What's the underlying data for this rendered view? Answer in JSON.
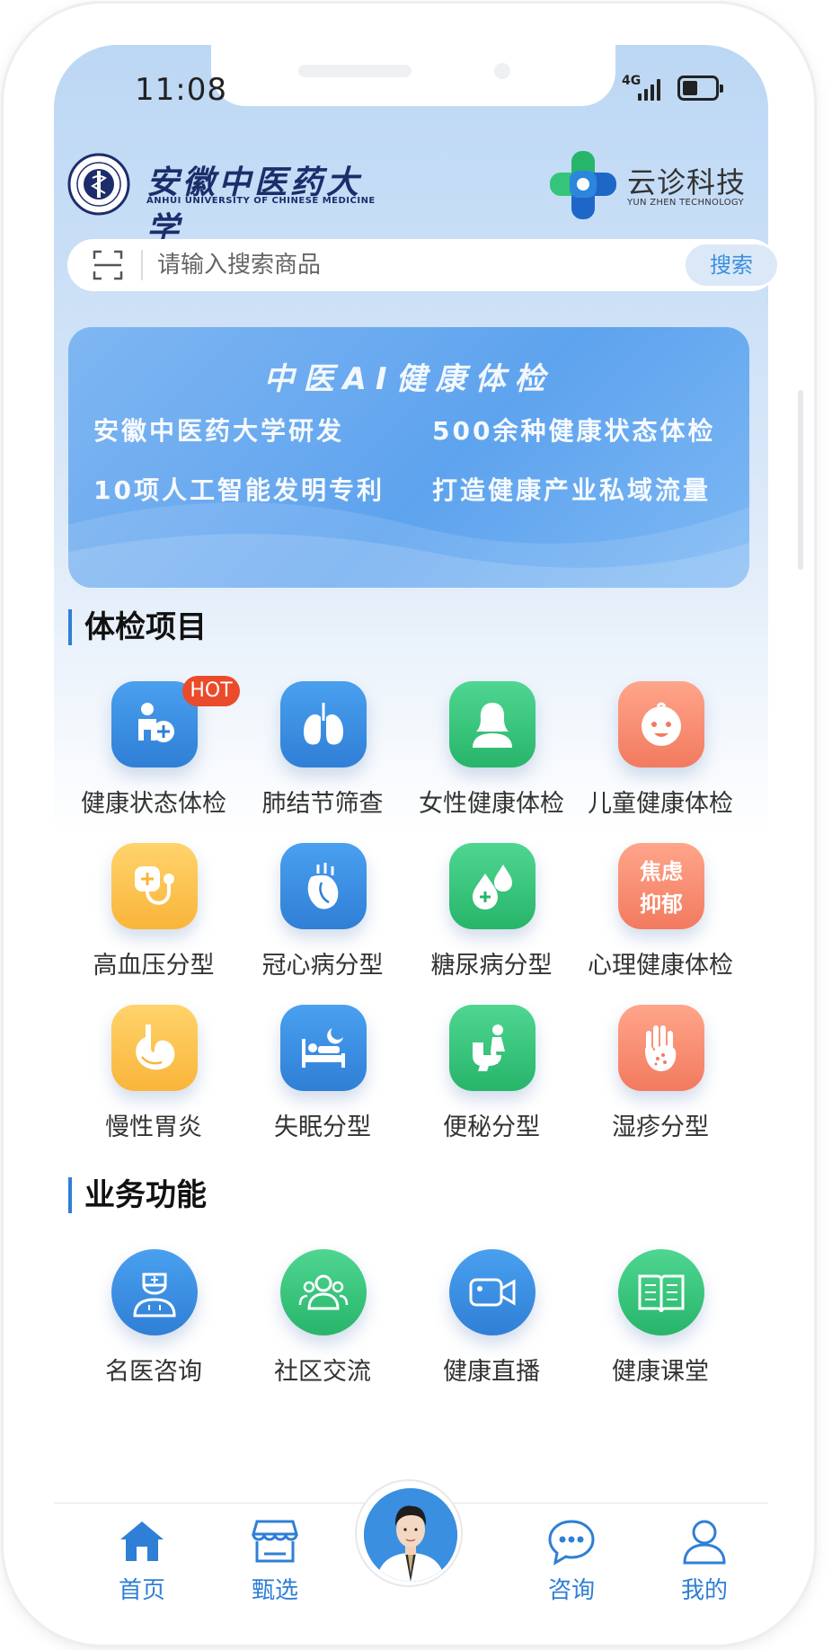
{
  "status_bar": {
    "time": "11:08",
    "network": "4G"
  },
  "header": {
    "university_cn": "安徽中医药大学",
    "university_en": "ANHUI UNIVERSITY OF CHINESE MEDICINE",
    "brand_cn": "云诊科技",
    "brand_en": "YUN ZHEN TECHNOLOGY"
  },
  "search": {
    "placeholder": "请输入搜索商品",
    "button_label": "搜索"
  },
  "banner": {
    "title": "中医AI健康体检",
    "items": [
      "安徽中医药大学研发",
      "500余种健康状态体检",
      "10项人工智能发明专利",
      "打造健康产业私域流量"
    ]
  },
  "exam_section": {
    "title": "体检项目",
    "hot_badge": "HOT",
    "items": [
      {
        "label": "健康状态体检",
        "icon": "person-plus-icon",
        "color": "#2f7fd6"
      },
      {
        "label": "肺结节筛查",
        "icon": "lungs-icon",
        "color": "#2f7fd6"
      },
      {
        "label": "女性健康体检",
        "icon": "woman-icon",
        "color": "#27b56a"
      },
      {
        "label": "儿童健康体检",
        "icon": "baby-face-icon",
        "color": "#f27a5f"
      },
      {
        "label": "高血压分型",
        "icon": "stethoscope-icon",
        "color": "#f9b53a"
      },
      {
        "label": "冠心病分型",
        "icon": "heart-organ-icon",
        "color": "#2f7fd6"
      },
      {
        "label": "糖尿病分型",
        "icon": "drops-icon",
        "color": "#27b56a"
      },
      {
        "label": "心理健康体检",
        "icon": "anxiety-text-icon",
        "color": "#f27a5f",
        "tile_text": [
          "焦虑",
          "抑郁"
        ]
      },
      {
        "label": "慢性胃炎",
        "icon": "stomach-icon",
        "color": "#f9b53a"
      },
      {
        "label": "失眠分型",
        "icon": "bed-moon-icon",
        "color": "#2f7fd6"
      },
      {
        "label": "便秘分型",
        "icon": "toilet-person-icon",
        "color": "#27b56a"
      },
      {
        "label": "湿疹分型",
        "icon": "hand-rash-icon",
        "color": "#f27a5f"
      }
    ]
  },
  "business_section": {
    "title": "业务功能",
    "items": [
      {
        "label": "名医咨询",
        "icon": "doctor-icon"
      },
      {
        "label": "社区交流",
        "icon": "community-icon"
      },
      {
        "label": "健康直播",
        "icon": "video-camera-icon"
      },
      {
        "label": "健康课堂",
        "icon": "book-icon"
      }
    ]
  },
  "bottom_nav": {
    "items": [
      {
        "label": "首页",
        "icon": "home-icon"
      },
      {
        "label": "甄选",
        "icon": "store-icon"
      },
      {
        "label": "",
        "icon": "doctor-avatar"
      },
      {
        "label": "咨询",
        "icon": "chat-icon"
      },
      {
        "label": "我的",
        "icon": "user-icon"
      }
    ]
  },
  "colors": {
    "primary": "#2f7fd6",
    "hot_badge": "#ea4b2a",
    "nav_text": "#2f7fd6"
  }
}
